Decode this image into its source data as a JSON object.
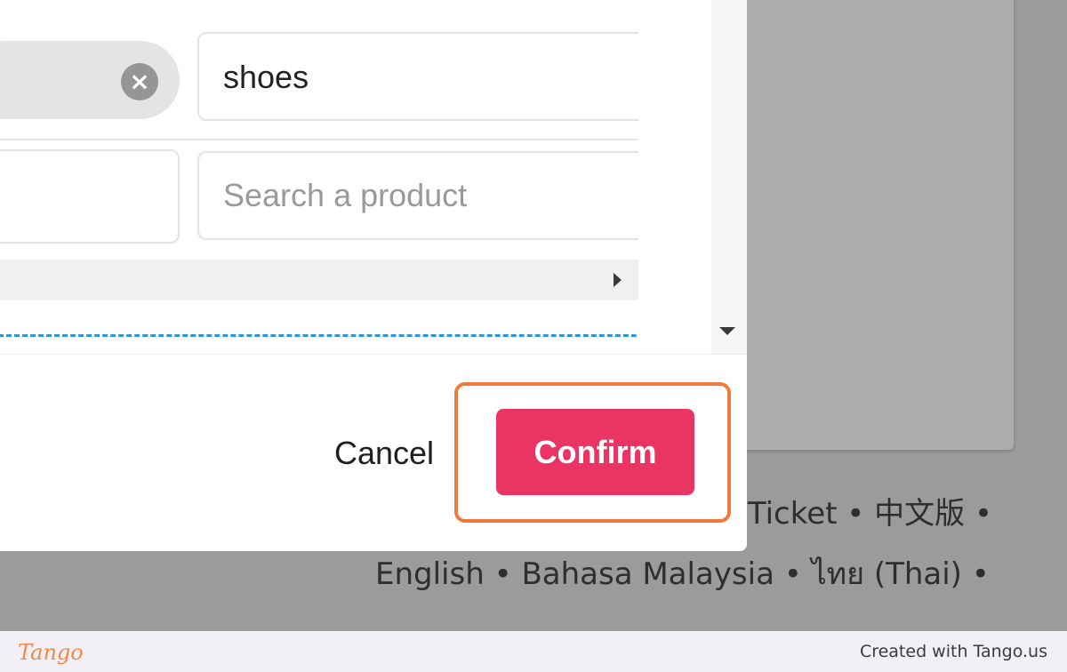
{
  "background": {
    "languages_line1": "Ticket • 中文版 •",
    "languages_line2": "English • Bahasa Malaysia • ไทย (Thai) •"
  },
  "modal": {
    "keyword_input": {
      "value": "shoes"
    },
    "chip_clear_icon": "clear-circle-icon",
    "product_search": {
      "placeholder": "Search a product"
    },
    "buttons": {
      "cancel_label": "Cancel",
      "confirm_label": "Confirm"
    },
    "colors": {
      "confirm": "#ea3564",
      "highlight": "#f07a3e",
      "dropzone_border": "#2e95e0"
    }
  },
  "watermark": {
    "logo": "Tango",
    "credit": "Created with Tango.us"
  }
}
